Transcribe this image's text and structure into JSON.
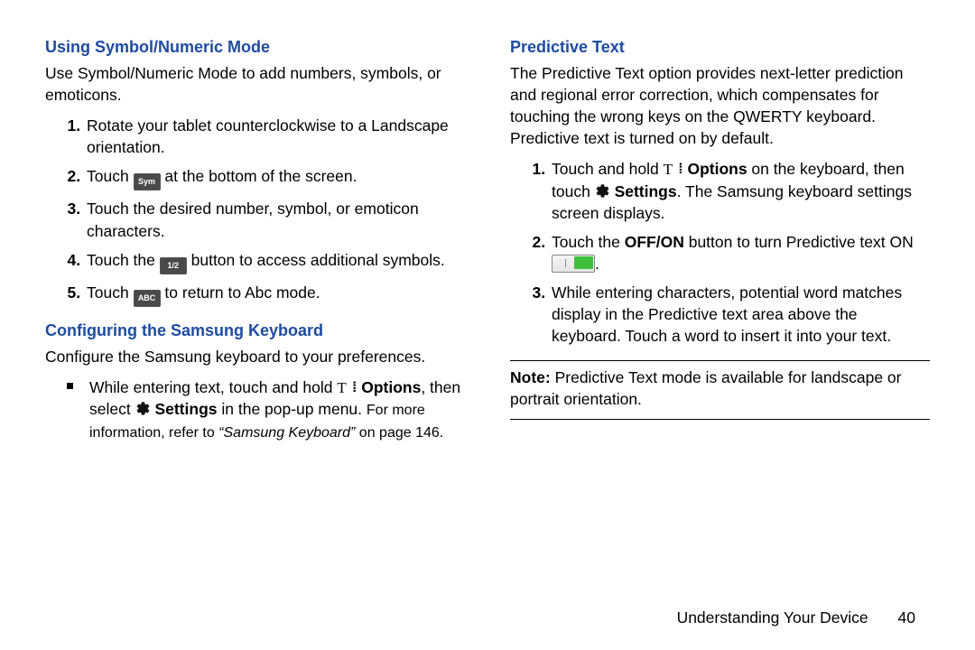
{
  "left": {
    "h_symbolic": "Using Symbol/Numeric Mode",
    "symbolic_intro": "Use Symbol/Numeric Mode to add numbers, symbols, or emoticons.",
    "steps_symbolic": {
      "s1": "Rotate your tablet counterclockwise to a Landscape orientation.",
      "s2a": "Touch ",
      "s2b": " at the bottom of the screen.",
      "s3": "Touch the desired number, symbol, or emoticon characters.",
      "s4a": "Touch the ",
      "s4b": " button to access additional symbols.",
      "s5a": "Touch ",
      "s5b": " to return to Abc mode."
    },
    "h_configure": "Configuring the Samsung Keyboard",
    "configure_intro": "Configure the Samsung keyboard to your preferences.",
    "configure_bullet_a": "While entering text, touch and hold ",
    "configure_options": "Options",
    "configure_then": ", then select ",
    "configure_settings": "Settings",
    "configure_b": " in the pop-up menu. ",
    "configure_c": "For more information, refer to ",
    "configure_ref": "“Samsung Keyboard”",
    "configure_d": " on page 146."
  },
  "right": {
    "h_predictive": "Predictive Text",
    "predictive_intro": "The Predictive Text option provides next-letter prediction and regional error correction, which compensates for touching the wrong keys on the QWERTY keyboard. Predictive text is turned on by default.",
    "p1a": "Touch and hold ",
    "p1_options": "Options",
    "p1b": " on the keyboard, then touch ",
    "p1_settings": "Settings",
    "p1c": ". The Samsung keyboard settings screen displays.",
    "p2a": "Touch the ",
    "p2_offon": "OFF/ON",
    "p2b": " button to turn Predictive text ON ",
    "p2c": ".",
    "p3": "While entering characters, potential word matches display in the Predictive text area above the keyboard. Touch a word to insert it into your text.",
    "note_label": "Note:",
    "note_text": " Predictive Text mode is available for landscape or portrait orientation."
  },
  "icons": {
    "sym": "Sym",
    "half": "1/2",
    "abc": "ABC"
  },
  "footer": {
    "section": "Understanding Your Device",
    "page": "40"
  }
}
